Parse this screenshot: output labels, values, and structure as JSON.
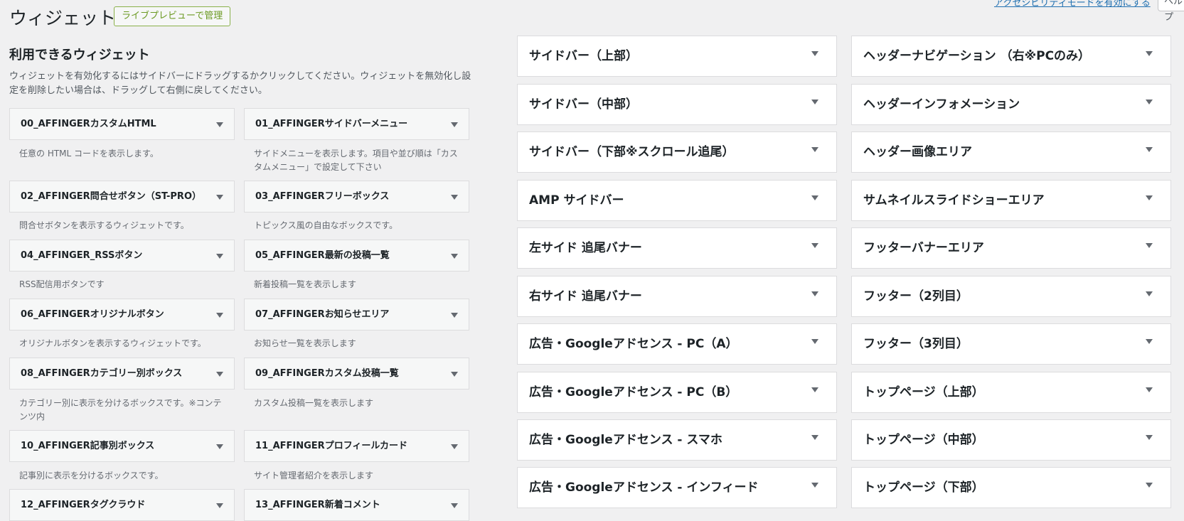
{
  "header": {
    "title": "ウィジェット",
    "live_preview_button": "ライブプレビューで管理",
    "accessibility_link": "アクセシビリティモードを有効にする",
    "help_tab": "ヘルプ"
  },
  "available": {
    "title": "利用できるウィジェット",
    "description": "ウィジェットを有効化するにはサイドバーにドラッグするかクリックしてください。ウィジェットを無効化し設定を削除したい場合は、ドラッグして右側に戻してください。",
    "widgets": [
      {
        "title": "00_AFFINGERカスタムHTML",
        "desc": "任意の HTML コードを表示します。"
      },
      {
        "title": "01_AFFINGERサイドバーメニュー",
        "desc": "サイドメニューを表示します。項目や並び順は「カスタムメニュー」で設定して下さい"
      },
      {
        "title": "02_AFFINGER問合せボタン（ST-PRO）",
        "desc": "問合せボタンを表示するウィジェットです。"
      },
      {
        "title": "03_AFFINGERフリーボックス",
        "desc": "トピックス風の自由なボックスです。"
      },
      {
        "title": "04_AFFINGER_RSSボタン",
        "desc": "RSS配信用ボタンです"
      },
      {
        "title": "05_AFFINGER最新の投稿一覧",
        "desc": "新着投稿一覧を表示します"
      },
      {
        "title": "06_AFFINGERオリジナルボタン",
        "desc": "オリジナルボタンを表示するウィジェットです。"
      },
      {
        "title": "07_AFFINGERお知らせエリア",
        "desc": "お知らせ一覧を表示します"
      },
      {
        "title": "08_AFFINGERカテゴリー別ボックス",
        "desc": "カテゴリー別に表示を分けるボックスです。※コンテンツ内"
      },
      {
        "title": "09_AFFINGERカスタム投稿一覧",
        "desc": "カスタム投稿一覧を表示します"
      },
      {
        "title": "10_AFFINGER記事別ボックス",
        "desc": "記事別に表示を分けるボックスです。"
      },
      {
        "title": "11_AFFINGERプロフィールカード",
        "desc": "サイト管理者紹介を表示します"
      },
      {
        "title": "12_AFFINGERタグクラウド",
        "desc": ""
      },
      {
        "title": "13_AFFINGER新着コメント",
        "desc": ""
      }
    ]
  },
  "areas_left": [
    {
      "title": "サイドバー（上部）"
    },
    {
      "title": "サイドバー（中部）"
    },
    {
      "title": "サイドバー（下部※スクロール追尾）"
    },
    {
      "title": "AMP サイドバー"
    },
    {
      "title": "左サイド 追尾バナー"
    },
    {
      "title": "右サイド 追尾バナー"
    },
    {
      "title": "広告・Googleアドセンス - PC（A）"
    },
    {
      "title": "広告・Googleアドセンス - PC（B）"
    },
    {
      "title": "広告・Googleアドセンス - スマホ"
    },
    {
      "title": "広告・Googleアドセンス - インフィード"
    }
  ],
  "areas_right": [
    {
      "title": "ヘッダーナビゲーション （右※PCのみ）"
    },
    {
      "title": "ヘッダーインフォメーション"
    },
    {
      "title": "ヘッダー画像エリア"
    },
    {
      "title": "サムネイルスライドショーエリア"
    },
    {
      "title": "フッターバナーエリア"
    },
    {
      "title": "フッター（2列目）"
    },
    {
      "title": "フッター（3列目）"
    },
    {
      "title": "トップページ（上部）"
    },
    {
      "title": "トップページ（中部）"
    },
    {
      "title": "トップページ（下部）"
    }
  ]
}
